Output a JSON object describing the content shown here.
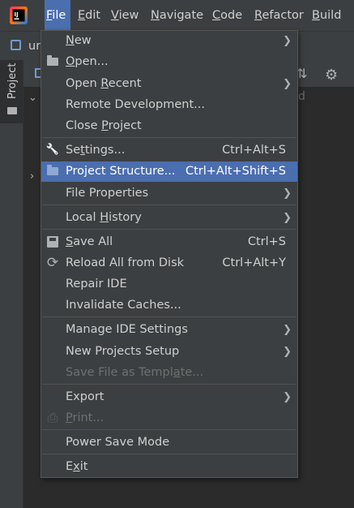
{
  "menubar": {
    "items": [
      {
        "label": "File",
        "mnemonic_index": 0
      },
      {
        "label": "Edit",
        "mnemonic_index": 0
      },
      {
        "label": "View",
        "mnemonic_index": 0
      },
      {
        "label": "Navigate",
        "mnemonic_index": 0
      },
      {
        "label": "Code",
        "mnemonic_index": 0
      },
      {
        "label": "Refactor",
        "mnemonic_index": 0
      },
      {
        "label": "Build",
        "mnemonic_index": 0
      }
    ],
    "active": "File"
  },
  "navbar": {
    "project_name_partial": "un"
  },
  "toolwindow": {
    "project_tab_label": "Project"
  },
  "panel": {
    "dim_text": "d"
  },
  "file_menu": {
    "items": [
      {
        "id": "new",
        "label_pre": "",
        "label_u": "N",
        "label_post": "ew",
        "shortcut": "",
        "submenu": true,
        "icon": "",
        "disabled": false,
        "selected": false
      },
      {
        "id": "open",
        "label_pre": "",
        "label_u": "O",
        "label_post": "pen...",
        "shortcut": "",
        "submenu": false,
        "icon": "folder-open-icon",
        "disabled": false,
        "selected": false
      },
      {
        "id": "open-recent",
        "label_pre": "Open ",
        "label_u": "R",
        "label_post": "ecent",
        "shortcut": "",
        "submenu": true,
        "icon": "",
        "disabled": false,
        "selected": false
      },
      {
        "id": "remote-development",
        "label_pre": "Remote Development...",
        "label_u": "",
        "label_post": "",
        "shortcut": "",
        "submenu": false,
        "icon": "",
        "disabled": false,
        "selected": false
      },
      {
        "id": "close-project",
        "label_pre": "Close ",
        "label_u": "P",
        "label_post": "roject",
        "shortcut": "",
        "submenu": false,
        "icon": "",
        "disabled": false,
        "selected": false
      },
      {
        "id": "settings",
        "label_pre": "Se",
        "label_u": "t",
        "label_post": "tings...",
        "shortcut": "Ctrl+Alt+S",
        "submenu": false,
        "icon": "wrench-icon",
        "disabled": false,
        "selected": false
      },
      {
        "id": "project-structure",
        "label_pre": "Project Structure...",
        "label_u": "",
        "label_post": "",
        "shortcut": "Ctrl+Alt+Shift+S",
        "submenu": false,
        "icon": "folder-icon",
        "disabled": false,
        "selected": true
      },
      {
        "id": "file-properties",
        "label_pre": "File Properties",
        "label_u": "",
        "label_post": "",
        "shortcut": "",
        "submenu": true,
        "icon": "",
        "disabled": false,
        "selected": false
      },
      {
        "id": "local-history",
        "label_pre": "Local ",
        "label_u": "H",
        "label_post": "istory",
        "shortcut": "",
        "submenu": true,
        "icon": "",
        "disabled": false,
        "selected": false
      },
      {
        "id": "save-all",
        "label_pre": "",
        "label_u": "S",
        "label_post": "ave All",
        "shortcut": "Ctrl+S",
        "submenu": false,
        "icon": "save-icon",
        "disabled": false,
        "selected": false
      },
      {
        "id": "reload-all",
        "label_pre": "Reload All from Disk",
        "label_u": "",
        "label_post": "",
        "shortcut": "Ctrl+Alt+Y",
        "submenu": false,
        "icon": "reload-icon",
        "disabled": false,
        "selected": false
      },
      {
        "id": "repair-ide",
        "label_pre": "Repair IDE",
        "label_u": "",
        "label_post": "",
        "shortcut": "",
        "submenu": false,
        "icon": "",
        "disabled": false,
        "selected": false
      },
      {
        "id": "invalidate-caches",
        "label_pre": "Invalidate Caches...",
        "label_u": "",
        "label_post": "",
        "shortcut": "",
        "submenu": false,
        "icon": "",
        "disabled": false,
        "selected": false
      },
      {
        "id": "manage-ide-settings",
        "label_pre": "Manage IDE Settings",
        "label_u": "",
        "label_post": "",
        "shortcut": "",
        "submenu": true,
        "icon": "",
        "disabled": false,
        "selected": false
      },
      {
        "id": "new-projects-setup",
        "label_pre": "New Projects Setup",
        "label_u": "",
        "label_post": "",
        "shortcut": "",
        "submenu": true,
        "icon": "",
        "disabled": false,
        "selected": false
      },
      {
        "id": "save-file-as-template",
        "label_pre": "Save File as Templ",
        "label_u": "a",
        "label_post": "te...",
        "shortcut": "",
        "submenu": false,
        "icon": "",
        "disabled": true,
        "selected": false
      },
      {
        "id": "export",
        "label_pre": "Export",
        "label_u": "",
        "label_post": "",
        "shortcut": "",
        "submenu": true,
        "icon": "",
        "disabled": false,
        "selected": false
      },
      {
        "id": "print",
        "label_pre": "",
        "label_u": "P",
        "label_post": "rint...",
        "shortcut": "",
        "submenu": false,
        "icon": "print-icon",
        "disabled": true,
        "selected": false
      },
      {
        "id": "power-save-mode",
        "label_pre": "Power Save Mode",
        "label_u": "",
        "label_post": "",
        "shortcut": "",
        "submenu": false,
        "icon": "",
        "disabled": false,
        "selected": false
      },
      {
        "id": "exit",
        "label_pre": "E",
        "label_u": "x",
        "label_post": "it",
        "shortcut": "",
        "submenu": false,
        "icon": "",
        "disabled": false,
        "selected": false
      }
    ]
  },
  "colors": {
    "selection": "#4b6eaf",
    "menu_bg": "#3c3f41",
    "editor_bg": "#2b2b2b",
    "text": "#cfcfcf",
    "disabled_text": "#6f6f6f"
  }
}
